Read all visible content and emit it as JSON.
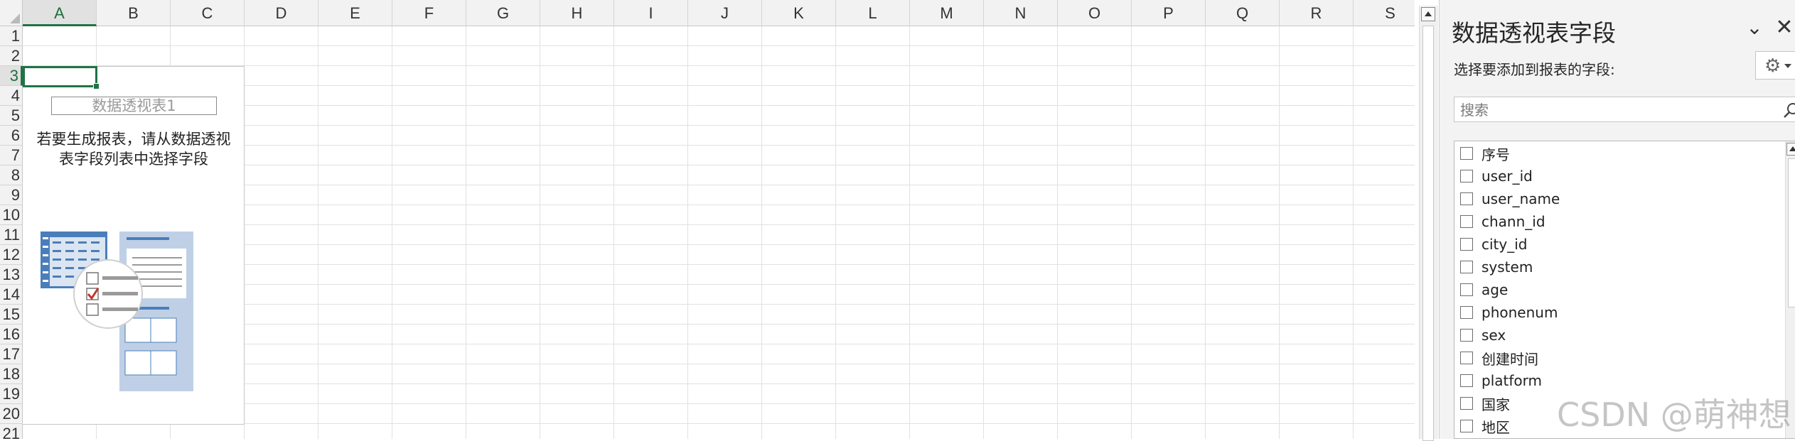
{
  "sheet": {
    "columns": [
      "A",
      "B",
      "C",
      "D",
      "E",
      "F",
      "G",
      "H",
      "I",
      "J",
      "K",
      "L",
      "M",
      "N",
      "O",
      "P",
      "Q",
      "R",
      "S"
    ],
    "rows": [
      "1",
      "2",
      "3",
      "4",
      "5",
      "6",
      "7",
      "8",
      "9",
      "10",
      "11",
      "12",
      "13",
      "14",
      "15",
      "16",
      "17",
      "18",
      "19",
      "20",
      "21"
    ],
    "active_column": "A",
    "active_row": "3"
  },
  "pivot_placeholder": {
    "name": "数据透视表1",
    "instruction_line1": "若要生成报表，请从数据透视",
    "instruction_line2": "表字段列表中选择字段"
  },
  "pane": {
    "title": "数据透视表字段",
    "subtitle": "选择要添加到报表的字段:",
    "search_placeholder": "搜索",
    "fields": [
      {
        "label": "序号",
        "checked": false
      },
      {
        "label": "user_id",
        "checked": false
      },
      {
        "label": "user_name",
        "checked": false
      },
      {
        "label": "chann_id",
        "checked": false
      },
      {
        "label": "city_id",
        "checked": false
      },
      {
        "label": "system",
        "checked": false
      },
      {
        "label": "age",
        "checked": false
      },
      {
        "label": "phonenum",
        "checked": false
      },
      {
        "label": "sex",
        "checked": false
      },
      {
        "label": "创建时间",
        "checked": false
      },
      {
        "label": "platform",
        "checked": false
      },
      {
        "label": "国家",
        "checked": false
      },
      {
        "label": "地区",
        "checked": false
      }
    ]
  },
  "watermark": "CSDN @萌神想",
  "colors": {
    "accent": "#217346",
    "illustration_blue": "#4a7ebb",
    "check_red": "#c0392b"
  }
}
